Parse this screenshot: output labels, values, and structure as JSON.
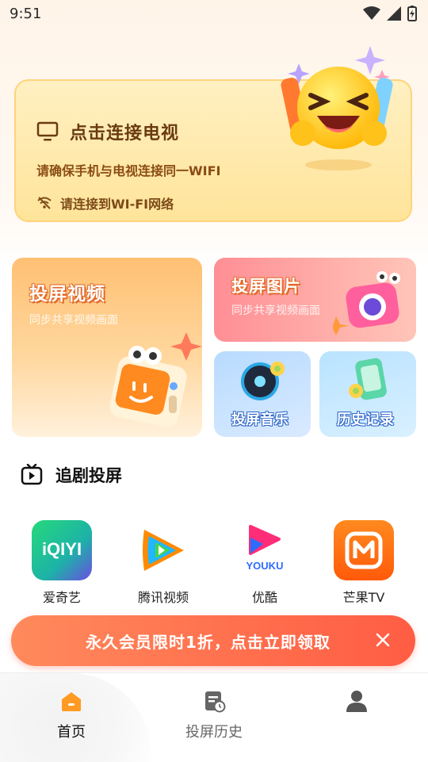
{
  "status_bar": {
    "time": "9:51"
  },
  "connect_card": {
    "title": "点击连接电视",
    "subtitle": "请确保手机与电视连接同一WIFI",
    "wifi_hint": "请连接到WI-FI网络"
  },
  "features": {
    "screen_video": {
      "title": "投屏视频",
      "subtitle": "同步共享视频画面"
    },
    "screen_photo": {
      "title": "投屏图片",
      "subtitle": "同步共享视频画面"
    },
    "screen_music": {
      "title": "投屏音乐"
    },
    "history": {
      "title": "历史记录"
    }
  },
  "section": {
    "title": "追剧投屏"
  },
  "apps": [
    {
      "label": "爱奇艺",
      "logo_text": "iQIYI",
      "icon": "iqiyi-logo",
      "color": "#1fcf6a"
    },
    {
      "label": "腾讯视频",
      "icon": "tencent-video-logo",
      "color": "#ff8a00"
    },
    {
      "label": "优酷",
      "logo_text": "YOUKU",
      "icon": "youku-logo",
      "color": "#ff3d8a"
    },
    {
      "label": "芒果TV",
      "icon": "mango-tv-logo",
      "color": "#ff6a1a"
    }
  ],
  "promo": {
    "text": "永久会员限时1折，点击立即领取"
  },
  "bottom_nav": {
    "home": "首页",
    "history": "投屏历史",
    "profile_icon": "person-icon"
  },
  "colors": {
    "accent_orange": "#ff6e4d",
    "card_yellow": "#ffe49a",
    "nav_active": "#ff9b24"
  }
}
